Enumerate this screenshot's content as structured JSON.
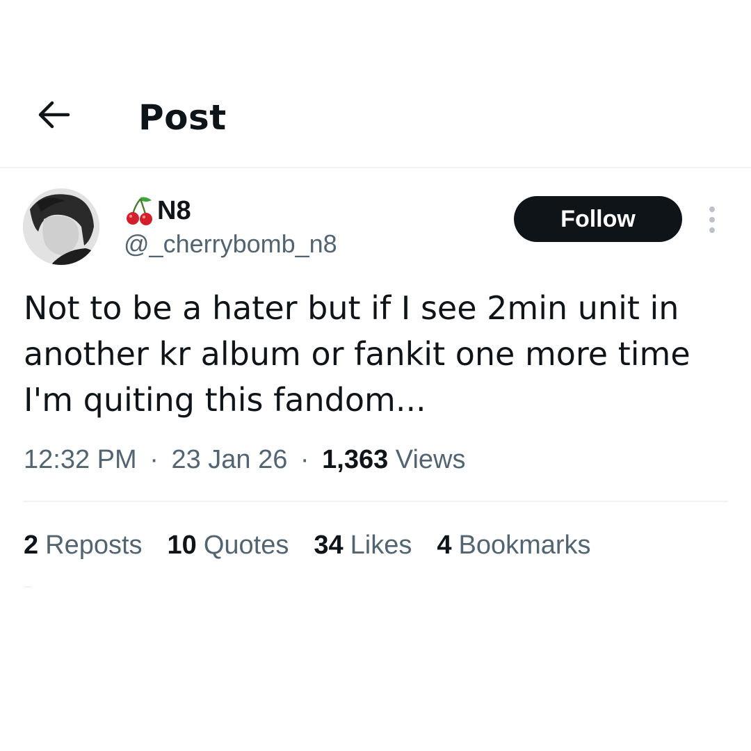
{
  "header": {
    "back_icon": "arrow-left-icon",
    "title": "Post"
  },
  "author": {
    "emoji_icon": "cherry-icon",
    "display_name": "N8",
    "handle": "@_cherrybomb_n8",
    "avatar": "avatar-photo"
  },
  "actions": {
    "follow_label": "Follow",
    "more_icon": "more-vertical-icon"
  },
  "tweet": {
    "lines": [
      "Not to be a hater but if I see 2min unit in",
      "another kr album or fankit one more time",
      "I'm quiting this fandom..."
    ]
  },
  "meta": {
    "time": "12:32 PM",
    "separator": "·",
    "date": "23 Jan 26",
    "views_count": "1,363",
    "views_label": "Views"
  },
  "stats": [
    {
      "count": "2",
      "label": "Reposts"
    },
    {
      "count": "10",
      "label": "Quotes"
    },
    {
      "count": "34",
      "label": "Likes"
    },
    {
      "count": "4",
      "label": "Bookmarks"
    }
  ],
  "colors": {
    "text_primary": "#0f1419",
    "text_secondary": "#536471",
    "divider": "#eff3f4",
    "follow_bg": "#0f1419"
  }
}
